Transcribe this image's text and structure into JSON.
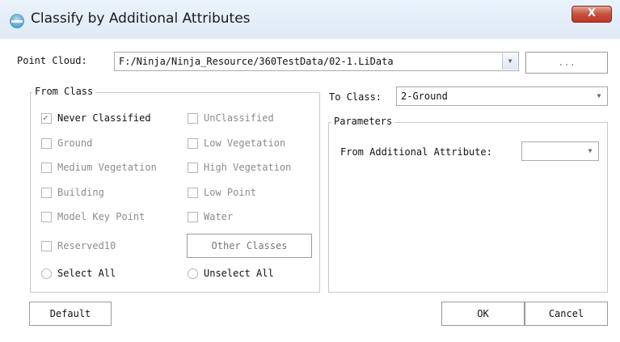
{
  "window": {
    "title": "Classify by Additional Attributes",
    "close_label": "X"
  },
  "point_cloud": {
    "label": "Point Cloud:",
    "value": "F:/Ninja/Ninja_Resource/360TestData/02-1.LiData",
    "browse_label": "..."
  },
  "from_class": {
    "title": "From Class",
    "items": [
      {
        "label": "Never Classified",
        "checked": true,
        "enabled": true
      },
      {
        "label": "UnClassified",
        "checked": false,
        "enabled": false
      },
      {
        "label": "Ground",
        "checked": false,
        "enabled": false
      },
      {
        "label": "Low Vegetation",
        "checked": false,
        "enabled": false
      },
      {
        "label": "Medium Vegetation",
        "checked": false,
        "enabled": false
      },
      {
        "label": "High Vegetation",
        "checked": false,
        "enabled": false
      },
      {
        "label": "Building",
        "checked": false,
        "enabled": false
      },
      {
        "label": "Low Point",
        "checked": false,
        "enabled": false
      },
      {
        "label": "Model Key Point",
        "checked": false,
        "enabled": false
      },
      {
        "label": "Water",
        "checked": false,
        "enabled": false
      },
      {
        "label": "Reserved10",
        "checked": false,
        "enabled": false
      }
    ],
    "other_classes_label": "Other Classes",
    "select_all_label": "Select All",
    "unselect_all_label": "Unselect All"
  },
  "to_class": {
    "label": "To Class:",
    "value": "2-Ground"
  },
  "parameters": {
    "title": "Parameters",
    "attribute_label": "From Additional Attribute:",
    "attribute_value": ""
  },
  "buttons": {
    "default_label": "Default",
    "ok_label": "OK",
    "cancel_label": "Cancel"
  }
}
